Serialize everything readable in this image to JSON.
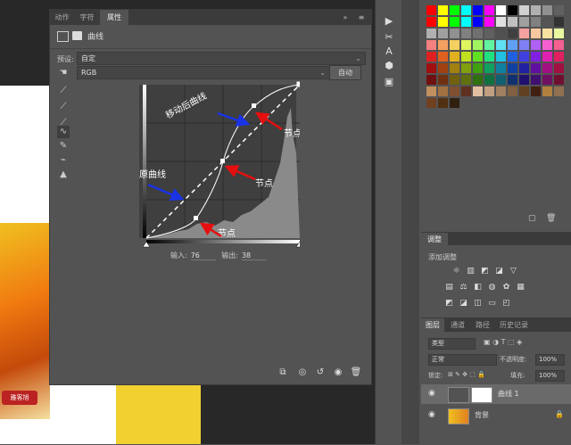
{
  "properties_panel": {
    "tabs": [
      "动作",
      "字符",
      "属性"
    ],
    "active_tab": "属性",
    "title": "曲线",
    "preset_label": "预设:",
    "preset_value": "自定",
    "channel_value": "RGB",
    "auto_label": "自动",
    "input_label": "输入:",
    "input_value": "76",
    "output_label": "输出:",
    "output_value": "38",
    "menu_icons": [
      "double-chevron-icon",
      "menu-icon"
    ]
  },
  "curve": {
    "annotation_moved": "移动后曲线",
    "annotation_original": "原曲线",
    "annotation_node": "节点",
    "colors": {
      "arrow_blue": "#1a33e6",
      "arrow_red": "#e60e0e",
      "curve": "#ffffff"
    }
  },
  "tools": [
    "target-adjust-icon",
    "black-eyedropper-icon",
    "gray-eyedropper-icon",
    "white-eyedropper-icon",
    "curve-point-icon",
    "pencil-icon",
    "smooth-icon",
    "clipping-warning-icon"
  ],
  "bottom_icons": [
    "clip-to-layer-icon",
    "view-previous-icon",
    "reset-icon",
    "visibility-icon",
    "trash-icon"
  ],
  "mid_tools": [
    "play-icon",
    "tools-icon",
    "text-a-icon",
    "cube-icon",
    "properties-icon"
  ],
  "adjustments": {
    "tab": "调整",
    "subtitle": "添加调整"
  },
  "layers": {
    "tabs": [
      "图层",
      "通道",
      "路径",
      "历史记录"
    ],
    "active_tab": "图层",
    "filter_value": "类型",
    "blend_mode": "正常",
    "opacity_label": "不透明度:",
    "opacity_value": "100%",
    "lock_label": "锁定:",
    "fill_label": "填充:",
    "fill_value": "100%",
    "items": [
      {
        "name": "曲线 1",
        "selected": true
      },
      {
        "name": "背景",
        "locked": true
      }
    ]
  },
  "document": {
    "badge": "雅客旭"
  }
}
